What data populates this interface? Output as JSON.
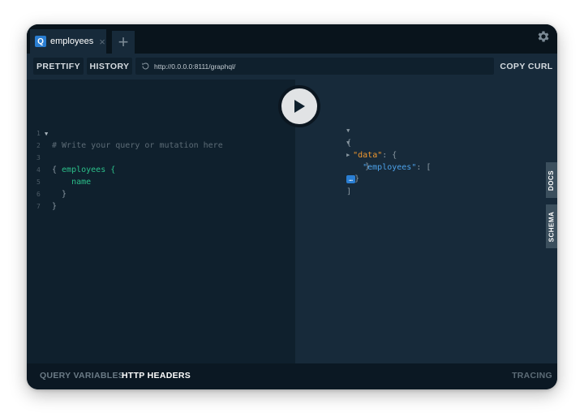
{
  "tabs": [
    {
      "badge": "Q",
      "label": "employees",
      "close": "×"
    }
  ],
  "add_tab_label": "+",
  "toolbar": {
    "prettify": "PRETTIFY",
    "history": "HISTORY",
    "url": "http://0.0.0.0:8111/graphql/",
    "copy_curl": "COPY CURL"
  },
  "editor": {
    "line_numbers": [
      "1",
      "2",
      "3",
      "4",
      "5",
      "6",
      "7"
    ],
    "lines": [
      "# Write your query or mutation here",
      "{",
      "  employees {",
      "    name",
      "  }",
      "}",
      ""
    ]
  },
  "result": {
    "open_brace": "{",
    "data_key": "\"data\"",
    "colon_brace": ": {",
    "employees_key": "\"employees\"",
    "colon_bracket": ": [",
    "ellipsis": "…",
    "close_bracket": "]",
    "close_inner": "}",
    "close_outer": "}"
  },
  "side_tabs": {
    "docs": "DOCS",
    "schema": "SCHEMA"
  },
  "bottom": {
    "query_variables": "QUERY VARIABLES",
    "http_headers": "HTTP HEADERS",
    "tracing": "TRACING"
  },
  "icons": [
    "gear-icon",
    "reload-icon",
    "play-icon",
    "close-icon",
    "plus-icon"
  ],
  "colors": {
    "accent": "#2a7ed2",
    "editor_bg": "#0f202d",
    "result_bg": "#172a3a",
    "field_green": "#2bbf8a",
    "key_orange": "#f0982f",
    "key_blue": "#4da1e8"
  }
}
